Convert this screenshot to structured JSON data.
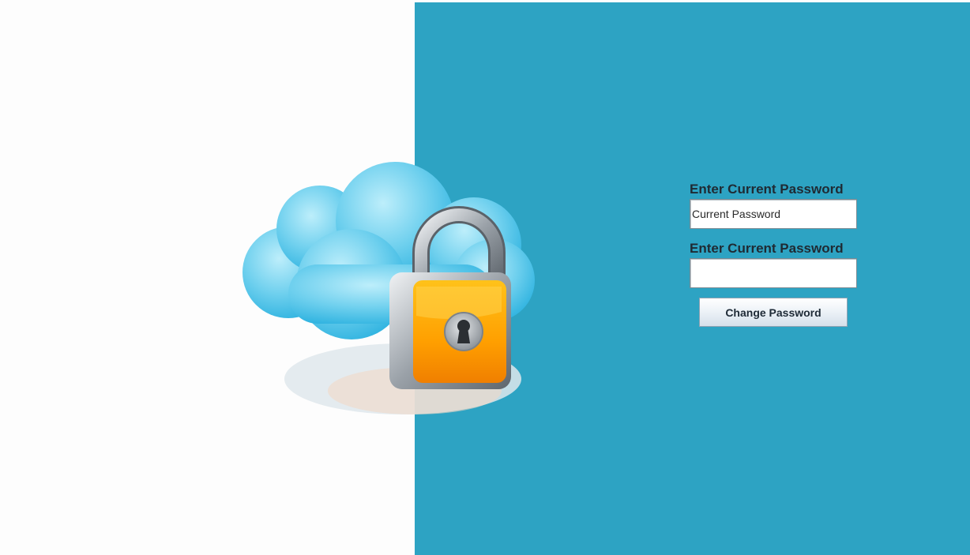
{
  "illustration": {
    "icon": "cloud-padlock-icon",
    "colors": {
      "cloud": "#5cc4e6",
      "lock_body": "#ff9f00",
      "shackle": "#c9cdd1"
    }
  },
  "panel": {
    "background": "#2da3c3"
  },
  "form": {
    "current_password_label": "Enter Current Password",
    "current_password_value": "Current Password",
    "second_password_label": "Enter Current Password",
    "second_password_value": "",
    "submit_label": "Change Password"
  }
}
